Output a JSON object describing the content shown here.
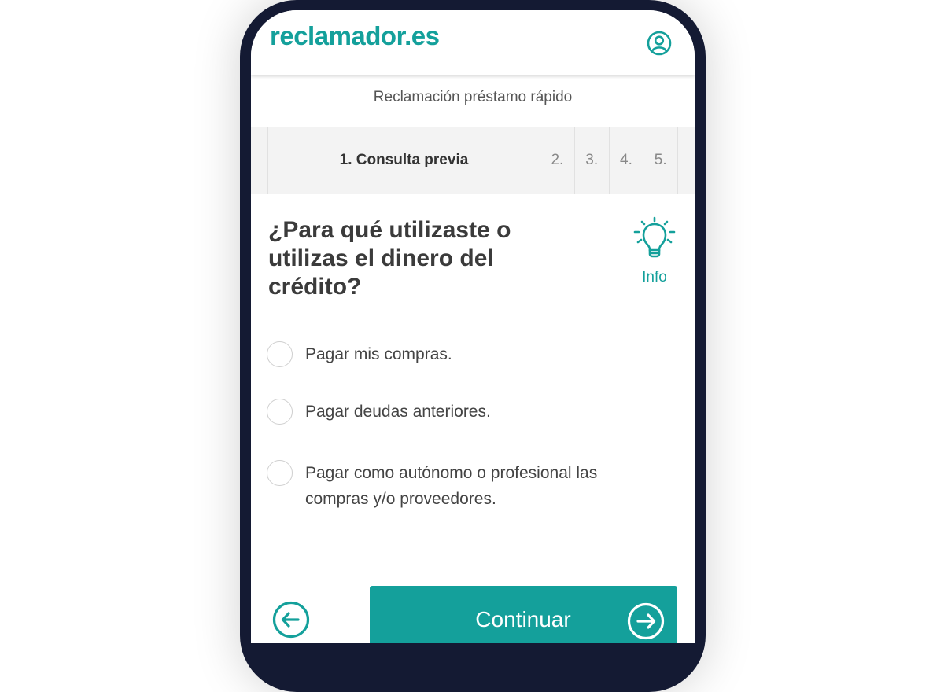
{
  "header": {
    "logo": "reclamador.es",
    "user_icon": "user-circle-icon"
  },
  "claim_title": "Reclamación préstamo rápido",
  "steps": [
    {
      "label": "1. Consulta previa",
      "active": true
    },
    {
      "label": "2.",
      "active": false
    },
    {
      "label": "3.",
      "active": false
    },
    {
      "label": "4.",
      "active": false
    },
    {
      "label": "5.",
      "active": false
    }
  ],
  "question": "¿Para qué utilizaste o utilizas el dinero del crédito?",
  "info": {
    "label": "Info",
    "icon": "lightbulb-icon"
  },
  "options": [
    {
      "label": "Pagar mis compras.",
      "selected": false
    },
    {
      "label": "Pagar deudas anteriores.",
      "selected": false
    },
    {
      "label": "Pagar como autónomo o profesional las compras y/o proveedores.",
      "selected": false
    }
  ],
  "footer": {
    "back_icon": "arrow-left-circle-icon",
    "continue_label": "Continuar",
    "continue_icon": "arrow-right-circle-icon"
  },
  "colors": {
    "accent": "#14a09b",
    "frame": "#141a33",
    "steps_bg": "#f3f3f3"
  }
}
